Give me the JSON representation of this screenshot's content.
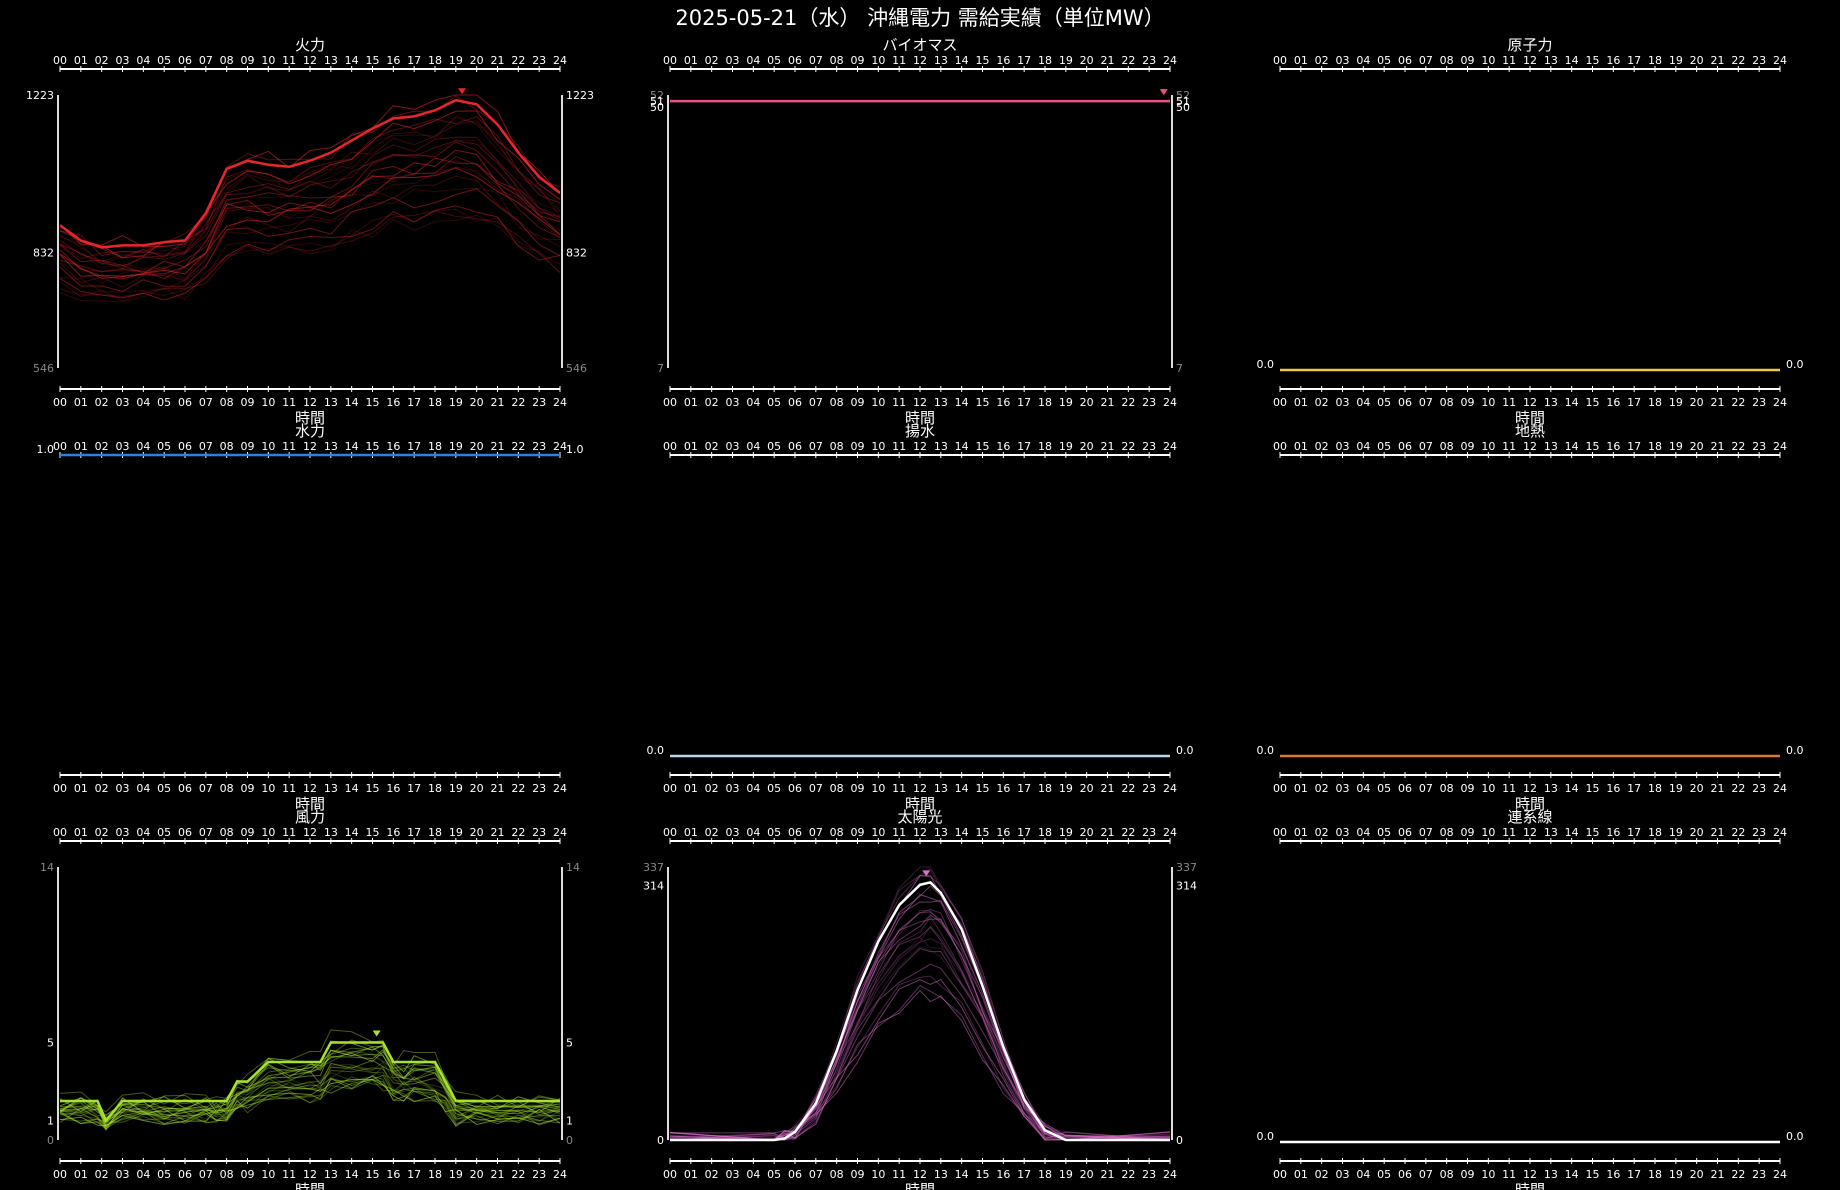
{
  "title": "2025-05-21（水） 沖縄電力 需給実績（単位MW）",
  "hours": [
    "00",
    "01",
    "02",
    "03",
    "04",
    "05",
    "06",
    "07",
    "08",
    "09",
    "10",
    "11",
    "12",
    "13",
    "14",
    "15",
    "16",
    "17",
    "18",
    "19",
    "20",
    "21",
    "22",
    "23",
    "24"
  ],
  "xlabel": "時間",
  "chart_data": [
    {
      "type": "line",
      "title": "火力",
      "color": "#e8272d",
      "ylim": [
        546,
        1223
      ],
      "yticks": [
        {
          "v": 1223,
          "label": "1223"
        },
        {
          "v": 832,
          "label": "832"
        },
        {
          "v": 546,
          "label": "546",
          "dim": true
        }
      ],
      "series": [
        {
          "name": "2025-05-21",
          "x": [
            0,
            1,
            2,
            3,
            4,
            5,
            6,
            7,
            8,
            9,
            10,
            11,
            12,
            13,
            14,
            15,
            16,
            17,
            18,
            19,
            20,
            21,
            22,
            23,
            24
          ],
          "values": [
            900,
            862,
            845,
            850,
            850,
            858,
            862,
            930,
            1040,
            1060,
            1050,
            1045,
            1060,
            1080,
            1110,
            1140,
            1165,
            1170,
            1185,
            1210,
            1200,
            1150,
            1080,
            1020,
            980
          ]
        }
      ],
      "peak_x": 19.3,
      "peak_v": 1210
    },
    {
      "type": "line",
      "title": "バイオマス",
      "color": "#f0508a",
      "ylim": [
        7,
        52
      ],
      "yticks": [
        {
          "v": 52,
          "label": "52",
          "dim": true
        },
        {
          "v": 51,
          "label": "51"
        },
        {
          "v": 50,
          "label": "50"
        },
        {
          "v": 7,
          "label": "7",
          "dim": true
        }
      ],
      "series": [
        {
          "name": "2025-05-21",
          "x": [
            0,
            24
          ],
          "values": [
            51,
            51
          ]
        }
      ],
      "peak_x": 23.7,
      "peak_v": 51
    },
    {
      "type": "line",
      "title": "原子力",
      "color": "#f2c744",
      "ylim": [
        0,
        1
      ],
      "yticks": [
        {
          "v": 0,
          "label": "0.0"
        }
      ],
      "series": [
        {
          "name": "2025-05-21",
          "x": [
            0,
            24
          ],
          "values": [
            0,
            0
          ]
        }
      ],
      "flat": true
    },
    {
      "type": "line",
      "title": "水力",
      "color": "#2f7fe0",
      "ylim": [
        0,
        1
      ],
      "yticks": [
        {
          "v": 1,
          "label": "1.0"
        }
      ],
      "series": [
        {
          "name": "2025-05-21",
          "x": [
            0,
            24
          ],
          "values": [
            1,
            1
          ]
        }
      ],
      "flat": true,
      "top": true
    },
    {
      "type": "line",
      "title": "揚水",
      "color": "#b9d6f0",
      "ylim": [
        0,
        1
      ],
      "yticks": [
        {
          "v": 0,
          "label": "0.0"
        }
      ],
      "series": [
        {
          "name": "2025-05-21",
          "x": [
            0,
            24
          ],
          "values": [
            0,
            0
          ]
        }
      ],
      "flat": true
    },
    {
      "type": "line",
      "title": "地熱",
      "color": "#e07a2b",
      "ylim": [
        0,
        1
      ],
      "yticks": [
        {
          "v": 0,
          "label": "0.0"
        }
      ],
      "series": [
        {
          "name": "2025-05-21",
          "x": [
            0,
            24
          ],
          "values": [
            0,
            0
          ]
        }
      ],
      "flat": true
    },
    {
      "type": "line",
      "title": "風力",
      "color": "#a6e22e",
      "ylim": [
        0,
        14
      ],
      "yticks": [
        {
          "v": 14,
          "label": "14",
          "dim": true
        },
        {
          "v": 5,
          "label": "5"
        },
        {
          "v": 1,
          "label": "1"
        },
        {
          "v": 0,
          "label": "0",
          "dim": true
        }
      ],
      "series": [
        {
          "name": "2025-05-21",
          "x": [
            0,
            1,
            1.8,
            2.2,
            3,
            4,
            5,
            6,
            7,
            7.5,
            8,
            8.5,
            9,
            10,
            11,
            12,
            12.5,
            13,
            14,
            15,
            15.5,
            16,
            16.5,
            17,
            18,
            18.5,
            19,
            20,
            21,
            22,
            23,
            24
          ],
          "values": [
            2,
            2,
            2,
            1,
            2,
            2,
            2,
            2,
            2,
            2,
            2,
            3,
            3,
            4,
            4,
            4,
            4,
            5,
            5,
            5,
            5,
            4,
            4,
            4,
            4,
            3,
            2,
            2,
            2,
            2,
            2,
            2
          ]
        }
      ],
      "peak_x": 15.2,
      "peak_v": 5
    },
    {
      "type": "line",
      "title": "太陽光",
      "color": "#e070d0",
      "ylim": [
        0,
        337
      ],
      "yticks": [
        {
          "v": 337,
          "label": "337",
          "dim": true
        },
        {
          "v": 314,
          "label": "314"
        },
        {
          "v": 0,
          "label": "0"
        }
      ],
      "series": [
        {
          "name": "2025-05-21",
          "x": [
            0,
            5,
            5.5,
            6,
            7,
            8,
            9,
            10,
            11,
            12,
            12.5,
            13,
            14,
            15,
            16,
            17,
            18,
            19,
            24
          ],
          "values": [
            0,
            0,
            2,
            10,
            45,
            110,
            185,
            245,
            290,
            315,
            318,
            305,
            260,
            190,
            115,
            50,
            12,
            0,
            0
          ]
        }
      ],
      "peak_x": 12.3,
      "peak_v": 318
    },
    {
      "type": "line",
      "title": "連系線",
      "color": "#ffffff",
      "ylim": [
        0,
        1
      ],
      "yticks": [
        {
          "v": 0,
          "label": "0.0"
        }
      ],
      "series": [
        {
          "name": "2025-05-21",
          "x": [
            0,
            24
          ],
          "values": [
            0,
            0
          ]
        }
      ],
      "flat": true
    }
  ]
}
